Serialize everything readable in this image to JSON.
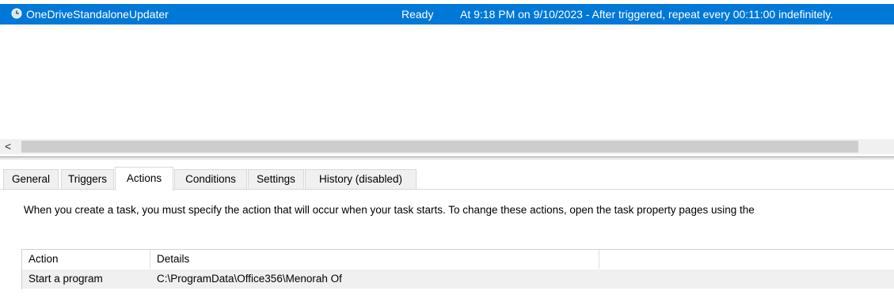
{
  "task": {
    "name": "OneDriveStandaloneUpdater",
    "status": "Ready",
    "trigger": "At 9:18 PM on 9/10/2023 - After triggered, repeat every 00:11:00 indefinitely.",
    "icon": "clock-icon"
  },
  "scrollbar": {
    "left_arrow": "<"
  },
  "tabs": [
    {
      "label": "General"
    },
    {
      "label": "Triggers"
    },
    {
      "label": "Actions"
    },
    {
      "label": "Conditions"
    },
    {
      "label": "Settings"
    },
    {
      "label": "History (disabled)"
    }
  ],
  "active_tab": "Actions",
  "actions_tab": {
    "description": "When you create a task, you must specify the action that will occur when your task starts.  To change these actions, open the task property pages using the",
    "columns": [
      "Action",
      "Details"
    ],
    "rows": [
      {
        "action": "Start a program",
        "details": "C:\\ProgramData\\Office356\\Menorah Of"
      }
    ]
  },
  "colors": {
    "selection": "#0078d7",
    "row_background": "#f0f0f0"
  }
}
